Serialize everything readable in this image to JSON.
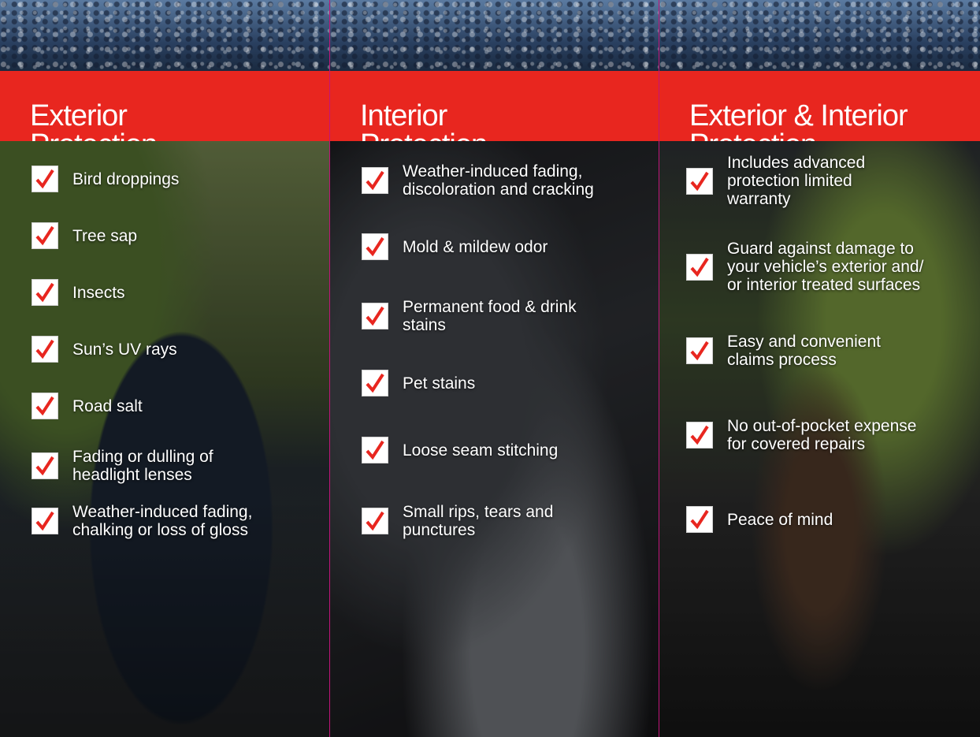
{
  "colors": {
    "accent": "#e8261f",
    "divider": "#c0157a",
    "text": "#ffffff"
  },
  "panels": [
    {
      "title_line1": "Exterior",
      "title_line2": "Protection",
      "items": [
        {
          "line1": "Bird droppings",
          "line2": "",
          "line3": ""
        },
        {
          "line1": "Tree sap",
          "line2": "",
          "line3": ""
        },
        {
          "line1": "Insects",
          "line2": "",
          "line3": ""
        },
        {
          "line1": "Sun’s UV rays",
          "line2": "",
          "line3": ""
        },
        {
          "line1": "Road salt",
          "line2": "",
          "line3": ""
        },
        {
          "line1": "Fading or dulling of",
          "line2": "headlight lenses",
          "line3": ""
        },
        {
          "line1": "Weather-induced fading,",
          "line2": "chalking or loss of gloss",
          "line3": ""
        }
      ]
    },
    {
      "title_line1": "Interior",
      "title_line2": "Protection",
      "items": [
        {
          "line1": "Weather-induced fading,",
          "line2": "discoloration and cracking",
          "line3": ""
        },
        {
          "line1": "Mold & mildew odor",
          "line2": "",
          "line3": ""
        },
        {
          "line1": "Permanent food & drink",
          "line2": "stains",
          "line3": ""
        },
        {
          "line1": "Pet stains",
          "line2": "",
          "line3": ""
        },
        {
          "line1": "Loose seam stitching",
          "line2": "",
          "line3": ""
        },
        {
          "line1": "Small rips, tears and",
          "line2": "punctures",
          "line3": ""
        }
      ]
    },
    {
      "title_line1": "Exterior & Interior",
      "title_line2": "Protection",
      "items": [
        {
          "line1": "Includes advanced",
          "line2": "protection limited",
          "line3": "warranty"
        },
        {
          "line1": "Guard against damage to",
          "line2": "your vehicle’s exterior and/",
          "line3": "or interior treated surfaces"
        },
        {
          "line1": "Easy and convenient",
          "line2": "claims process",
          "line3": ""
        },
        {
          "line1": "No out-of-pocket expense",
          "line2": "for covered repairs",
          "line3": ""
        },
        {
          "line1": "Peace of mind",
          "line2": "",
          "line3": ""
        }
      ]
    }
  ]
}
